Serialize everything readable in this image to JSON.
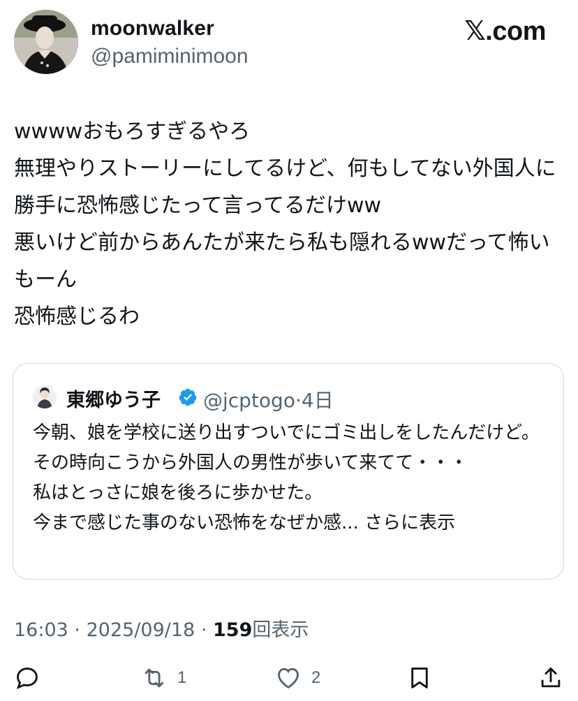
{
  "author": {
    "display_name": "moonwalker",
    "handle": "@pamiminimoon",
    "avatar_icon": "user-avatar"
  },
  "brand": "𝕏.com",
  "tweet": {
    "text": "wwwwおもろすぎるやろ\n無理やりストーリーにしてるけど、何もしてない外国人に勝手に恐怖感じたって言ってるだけww\n悪いけど前からあんたが来たら私も隠れるwwだって怖いもーん\n恐怖感じるわ"
  },
  "quoted": {
    "display_name": "東郷ゆう子",
    "verified_icon": "verified-badge-icon",
    "handle": "@jcptogo",
    "separator": "·",
    "age": "4日",
    "text": "今朝、娘を学校に送り出すついでにゴミ出しをしたんだけど。\nその時向こうから外国人の男性が歩いて来てて・・・\n私はとっさに娘を後ろに歩かせた。\n今まで感じた事のない恐怖をなぜか感...",
    "show_more": "さらに表示"
  },
  "meta": {
    "time": "16:03",
    "sep1": "·",
    "date": "2025/09/18",
    "sep2": "·",
    "views_count": "159",
    "views_label": "回表示"
  },
  "actions": {
    "reply_icon": "reply-icon",
    "retweet_icon": "retweet-icon",
    "retweet_count": "1",
    "like_icon": "heart-icon",
    "like_count": "2",
    "bookmark_icon": "bookmark-icon",
    "share_icon": "share-icon"
  },
  "colors": {
    "text": "#0f1419",
    "secondary": "#536471",
    "border": "#cfd9de",
    "verified": "#1d9bf0"
  }
}
